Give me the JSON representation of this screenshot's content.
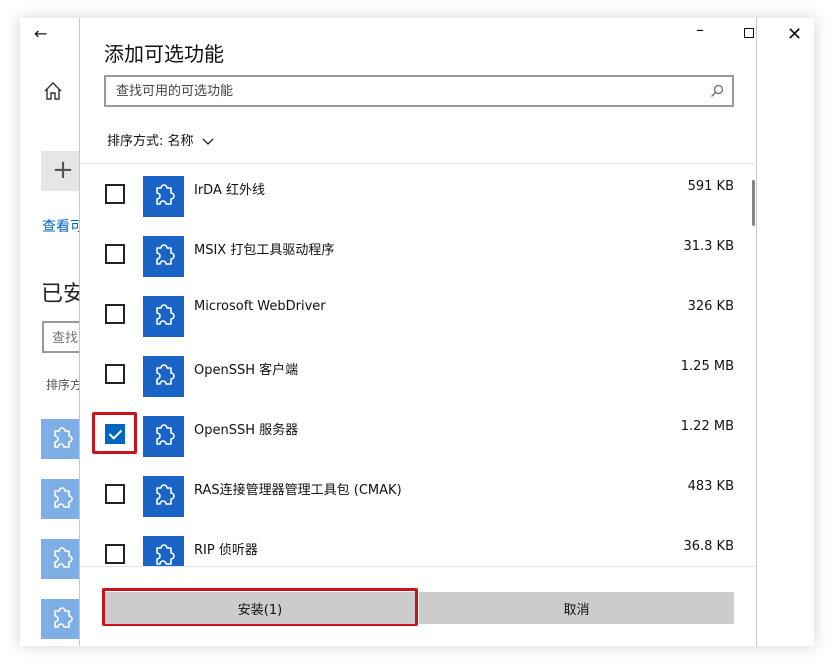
{
  "background_window": {
    "link_text": "查看可",
    "heading": "已安",
    "search_placeholder": "查找",
    "sort_text": "排序方"
  },
  "dialog": {
    "title": "添加可选功能",
    "search": {
      "placeholder": "查找可用的可选功能",
      "value": ""
    },
    "sort": {
      "label": "排序方式:",
      "value": "名称"
    },
    "features": [
      {
        "name": "IrDA 红外线",
        "size": "591 KB",
        "checked": false
      },
      {
        "name": "MSIX 打包工具驱动程序",
        "size": "31.3 KB",
        "checked": false
      },
      {
        "name": "Microsoft WebDriver",
        "size": "326 KB",
        "checked": false
      },
      {
        "name": "OpenSSH 客户端",
        "size": "1.25 MB",
        "checked": false
      },
      {
        "name": "OpenSSH 服务器",
        "size": "1.22 MB",
        "checked": true
      },
      {
        "name": "RAS连接管理器管理工具包 (CMAK)",
        "size": "483 KB",
        "checked": false
      },
      {
        "name": "RIP 侦听器",
        "size": "36.8 KB",
        "checked": false
      }
    ],
    "buttons": {
      "install": "安装(1)",
      "cancel": "取消"
    }
  },
  "colors": {
    "accent": "#0067c0",
    "feature_icon": "#1a64c8",
    "highlight": "#c8141c",
    "button": "#cccccc"
  },
  "icons": [
    "back-arrow-icon",
    "home-icon",
    "plus-icon",
    "close-icon",
    "minimize-icon",
    "maximize-icon",
    "search-icon",
    "chevron-down-icon",
    "puzzle-icon"
  ]
}
